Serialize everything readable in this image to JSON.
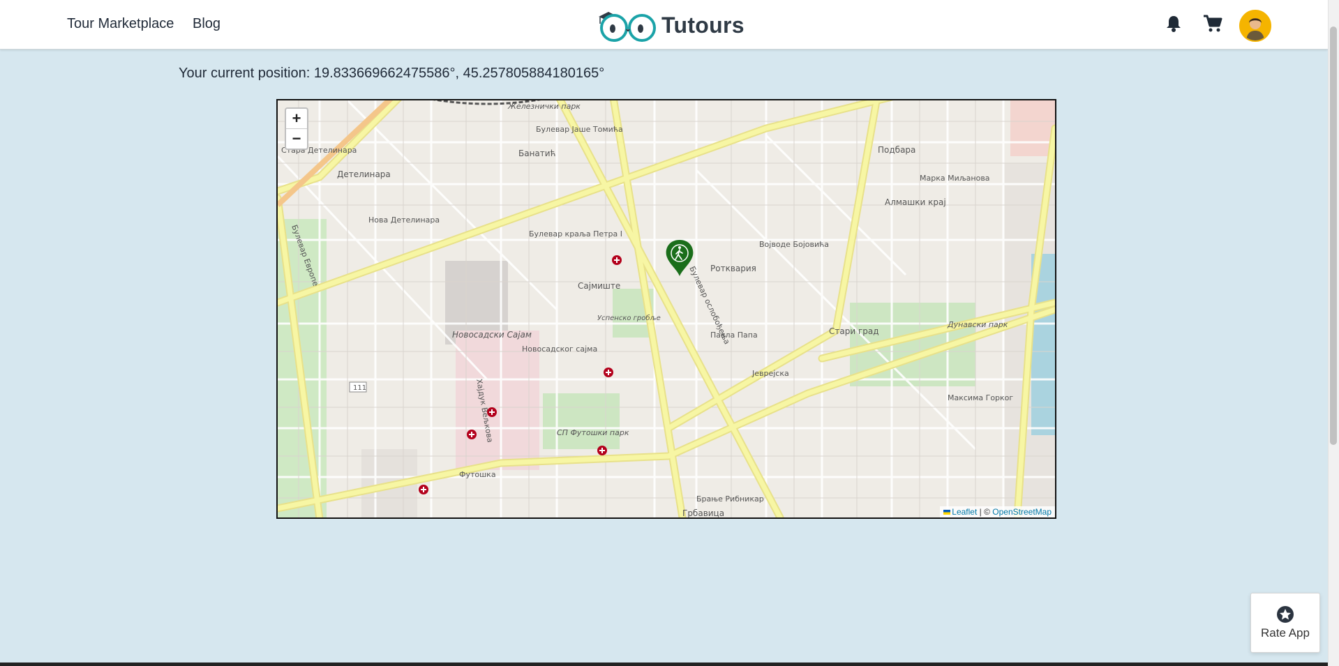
{
  "nav": {
    "tour_marketplace": "Tour Marketplace",
    "blog": "Blog",
    "logo_text": "Tutours"
  },
  "icons": {
    "bell": "bell-icon",
    "cart": "cart-icon",
    "avatar": "avatar",
    "marker": "walking-person-marker-icon",
    "star": "star-icon"
  },
  "position": {
    "text": "Your current position: 19.833669662475586°, 45.257805884180165°"
  },
  "map": {
    "zoom_in": "+",
    "zoom_out": "−",
    "attribution": {
      "leaflet": "Leaflet",
      "separator": " | © ",
      "osm": "OpenStreetMap"
    },
    "labels": {
      "l1": "Булевар Јаше Томића",
      "l2": "Детелинара",
      "l3": "Нова Детелинара",
      "l4": "Банатић",
      "l5": "Подбара",
      "l6": "Алмашки крај",
      "l7": "Булевар краља Петра I",
      "l8": "Војводе Бојовића",
      "l9": "Ротквария",
      "l10": "Сајмиште",
      "l11": "Новосадски Сајам",
      "l12": "Новосадског сајма",
      "l13": "Стари град",
      "l14": "Дунавски парк",
      "l15": "Јеврејска",
      "l16": "Футошка",
      "l17": "СП Футошки парк",
      "l18": "Брање Рибникар",
      "l19": "Грбавица",
      "l20": "Максима Горког",
      "l21": "Марка Миљанова",
      "l22": "Булевар Европе",
      "l23": "Хајдук Вељкова",
      "l24": "Булевар ослобођења",
      "l25": "Павла Папа",
      "l26": "Успенско гробље",
      "l27": "Стара Детелинара",
      "l28": "Железнички парк",
      "l29": "111"
    }
  },
  "rate_app": {
    "label": "Rate App"
  },
  "colors": {
    "page_bg": "#d6e7ef",
    "marker": "#1b6e1b",
    "hospital": "#b3001b",
    "road_yellow": "#f7f6a4"
  }
}
